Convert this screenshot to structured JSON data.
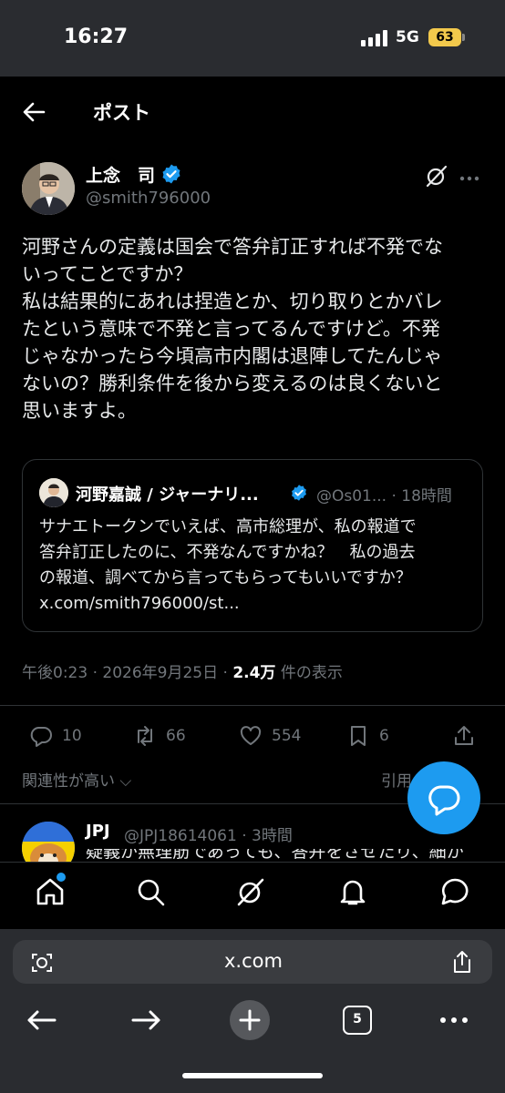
{
  "status_bar": {
    "time": "16:27",
    "network": "5G",
    "battery": "63"
  },
  "header": {
    "title": "ポスト"
  },
  "post": {
    "author_name": "上念　司",
    "handle": "@smith796000",
    "text": "河野さんの定義は国会で答弁訂正すれば不発でな\nいってことですか？\n私は結果的にあれは捏造とか、切り取りとかバレ\nたという意味で不発と言ってるんですけど。不発\nじゃなかったら今頃高市内閣は退陣してたんじゃ\nないの？勝利条件を後から変えるのは良くないと\n思いますよ。",
    "quote": {
      "author_name": "河野嘉誠 / ジャーナリ...",
      "handle_time": "@Os01... · 18時間",
      "text": "サナエトークンでいえば、高市総理が、私の報道で\n答弁訂正したのに、不発なんですかね？　私の過去\nの報道、調べてから言ってもらってもいいですか？\nx.com/smith796000/st..."
    },
    "meta": {
      "time": "午後0:23 · 2026年9月25日 · ",
      "views": "2.4万",
      "views_suffix": " 件の表示"
    },
    "actions": {
      "replies": "10",
      "reposts": "66",
      "likes": "554",
      "bookmarks": "6"
    },
    "sort_label": "関連性が高い",
    "quotes_label": "引用"
  },
  "reply": {
    "name": "JPJ",
    "handle_time": "@JPJ18614061 · 3時間",
    "text": "疑義が無理筋であっても、答弁をさせたり、細か"
  },
  "browser": {
    "url": "x.com",
    "tabs": "5"
  },
  "colors": {
    "accent": "#1d9bf0",
    "background": "#000000",
    "battery": "#f2c94c"
  }
}
